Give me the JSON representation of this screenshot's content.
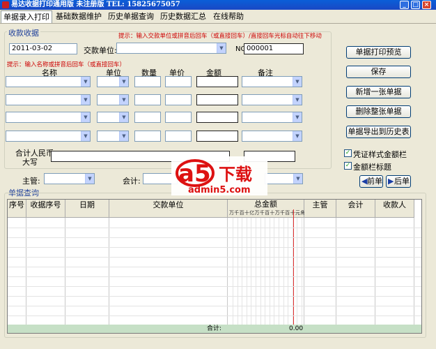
{
  "window": {
    "title": "易达收据打印通用版 未注册版    TEL: 15825675057",
    "buttons": {
      "minimize": "_",
      "maximize": "□",
      "close": "×"
    }
  },
  "tabs": [
    {
      "label": "单据录入打印",
      "active": true
    },
    {
      "label": "基础数据维护",
      "active": false
    },
    {
      "label": "历史单据查询",
      "active": false
    },
    {
      "label": "历史数据汇总",
      "active": false
    },
    {
      "label": "在线帮助",
      "active": false
    }
  ],
  "receipt": {
    "group_label": "收款收据",
    "hint_top": "提示：输入交款单位或拼音后回车（或直接回车）/直接回车光标自动往下移动",
    "date": "2011-03-02",
    "payer_label": "交款单位:",
    "payer_value": "",
    "no_label": "NO.",
    "no_value": "000001",
    "hint_items": "提示：输入名称或拼音后回车（或直接回车）",
    "columns": [
      "名称",
      "单位",
      "数量",
      "单价",
      "金额",
      "备注"
    ],
    "total_label_1": "合计人民币",
    "total_label_2": "大写",
    "supervisor_label": "主管:",
    "accountant_label": "会计:"
  },
  "actions": {
    "print_preview": "单据打印预览",
    "save": "保存",
    "new": "新增一张单据",
    "delete": "删除整张单据",
    "export": "单据导出到历史表",
    "chk_amount_style": "凭证样式金额栏",
    "chk_amount_title": "金额栏标题",
    "prev": "前单",
    "next": "后单"
  },
  "query": {
    "group_label": "单据查询",
    "columns": [
      "序号",
      "收据序号",
      "日期",
      "交款单位",
      "总金额",
      "主管",
      "会计",
      "收款人"
    ],
    "digit_header": "万千百十亿万千百十万千百十元角分",
    "total_label": "合计:",
    "total_value": "0.00"
  },
  "watermark": {
    "brand_a5": "a5",
    "brand_cn": "下载",
    "site": "admin5.com"
  }
}
